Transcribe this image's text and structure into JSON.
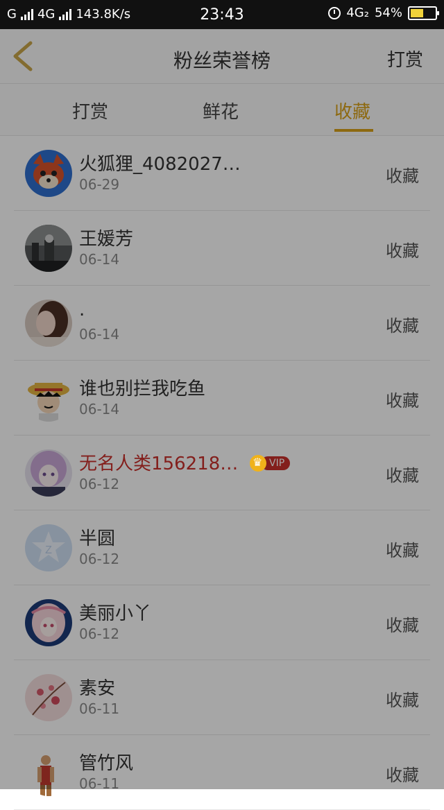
{
  "status": {
    "carrier_left": "G",
    "network": "4G",
    "speed": "143.8K/s",
    "time": "23:43",
    "network_right": "4G₂",
    "battery": "54%",
    "battery_level": 0.54
  },
  "nav": {
    "title": "粉丝荣誉榜",
    "action": "打赏"
  },
  "tabs": [
    {
      "label": "打赏",
      "active": false
    },
    {
      "label": "鲜花",
      "active": false
    },
    {
      "label": "收藏",
      "active": true
    }
  ],
  "colors": {
    "accent": "#d9a21a",
    "vip_name": "#c9302c"
  },
  "list": [
    {
      "name": "火狐狸_4082027…",
      "date": "06-29",
      "type": "收藏",
      "avatar": "fox-avatar"
    },
    {
      "name": "王媛芳",
      "date": "06-14",
      "type": "收藏",
      "avatar": "photo-avatar"
    },
    {
      "name": ".",
      "date": "06-14",
      "type": "收藏",
      "avatar": "girl-avatar"
    },
    {
      "name": "谁也别拦我吃鱼",
      "date": "06-14",
      "type": "收藏",
      "avatar": "luffy-avatar"
    },
    {
      "name": "无名人类156218…",
      "date": "06-12",
      "type": "收藏",
      "avatar": "anime-avatar",
      "vip": true,
      "vip_label": "VIP"
    },
    {
      "name": "半圆",
      "date": "06-12",
      "type": "收藏",
      "avatar": "default-qzone-avatar"
    },
    {
      "name": "美丽小丫",
      "date": "06-12",
      "type": "收藏",
      "avatar": "anime-girl-avatar"
    },
    {
      "name": "素安",
      "date": "06-11",
      "type": "收藏",
      "avatar": "flower-avatar"
    },
    {
      "name": "管竹风",
      "date": "06-11",
      "type": "收藏",
      "avatar": "figure-avatar"
    }
  ]
}
